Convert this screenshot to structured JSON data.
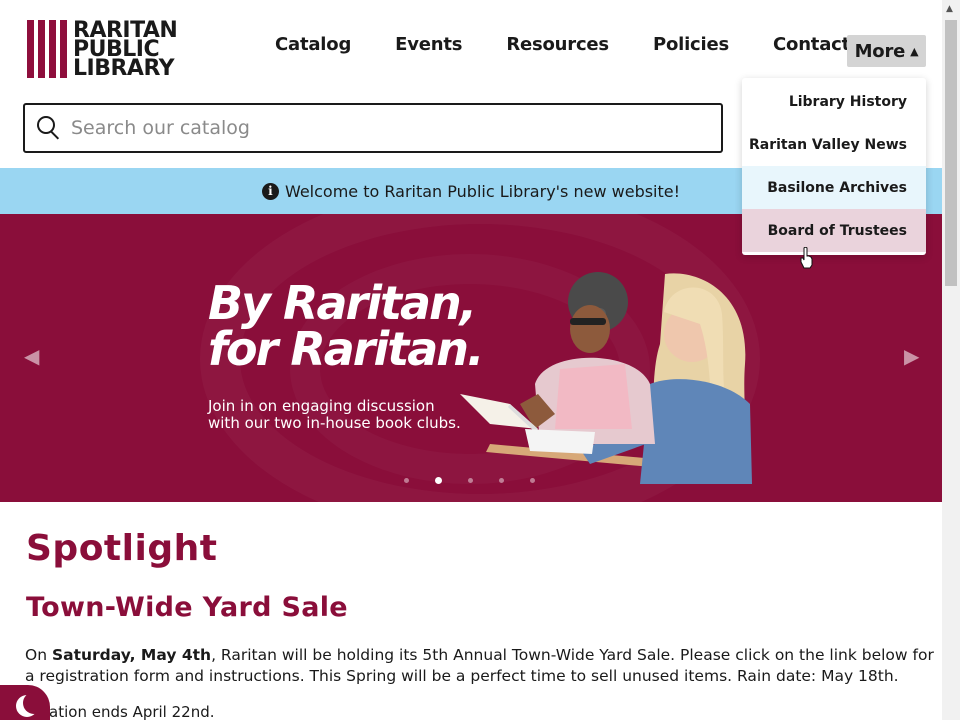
{
  "header": {
    "logo": {
      "line1": "RARITAN",
      "line2": "PUBLIC",
      "line3": "LIBRARY"
    },
    "nav": [
      "Catalog",
      "Events",
      "Resources",
      "Policies",
      "Contact"
    ],
    "more_label": "More",
    "more_dropdown": [
      "Library History",
      "Raritan Valley News",
      "Basilone Archives",
      "Board of Trustees"
    ]
  },
  "search": {
    "placeholder": "Search our catalog"
  },
  "banner": {
    "text": "Welcome to Raritan Public Library's new website!"
  },
  "hero": {
    "title_line1": "By Raritan,",
    "title_line2": "for Raritan.",
    "sub_line1": "Join in on engaging discussion",
    "sub_line2": "with our two in-house book clubs.",
    "slide_count": 5,
    "active_slide": 2
  },
  "content": {
    "section_title": "Spotlight",
    "article_title": "Town-Wide Yard Sale",
    "body_on": "On ",
    "body_date": "Saturday, May 4th",
    "body_rest": ", Raritan will be holding its 5th Annual Town-Wide Yard Sale. Please click on the link below for a registration form and instructions. This Spring will be a perfect time to sell unused items. Rain date: May 18th.",
    "note": "istration ends April 22nd."
  },
  "colors": {
    "brand": "#8a0e3a",
    "banner": "#9ad6f2"
  }
}
